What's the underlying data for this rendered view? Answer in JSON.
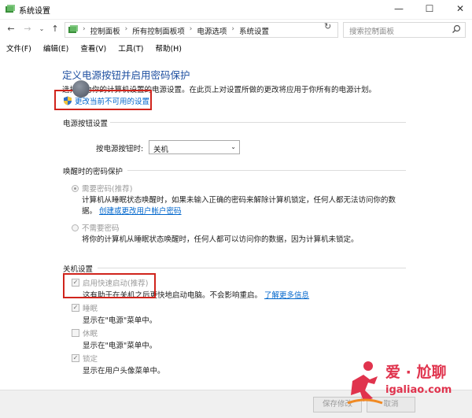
{
  "window": {
    "title": "系统设置",
    "min": "—",
    "max": "☐",
    "close": "✕"
  },
  "address": {
    "crumbs": [
      "控制面板",
      "所有控制面板项",
      "电源选项",
      "系统设置"
    ],
    "search_placeholder": "搜索控制面板"
  },
  "menu": [
    "文件(F)",
    "编辑(E)",
    "查看(V)",
    "工具(T)",
    "帮助(H)"
  ],
  "main": {
    "heading": "定义电源按钮并启用密码保护",
    "description": "选择要为你的计算机设置的电源设置。在此页上对设置所做的更改将应用于你所有的电源计划。",
    "change_link": "更改当前不可用的设置",
    "power_button": {
      "section": "电源按钮设置",
      "label": "按电源按钮时:",
      "value": "关机"
    },
    "wake_password": {
      "section": "唤醒时的密码保护",
      "require": {
        "label": "需要密码(推荐)",
        "desc1": "计算机从睡眠状态唤醒时，如果未输入正确的密码来解除计算机锁定，任何人都无法访问你的数",
        "desc2_prefix": "据。",
        "link": "创建或更改用户帐户密码"
      },
      "no_require": {
        "label": "不需要密码",
        "desc": "将你的计算机从睡眠状态唤醒时，任何人都可以访问你的数据，因为计算机未锁定。"
      }
    },
    "shutdown": {
      "section": "关机设置",
      "fast_startup": {
        "label": "启用快速启动(推荐)",
        "desc": "这有助于在关机之后更快地启动电脑。不会影响重启。",
        "link": "了解更多信息",
        "checked": true
      },
      "sleep": {
        "label": "睡眠",
        "desc": "显示在\"电源\"菜单中。",
        "checked": true
      },
      "hibernate": {
        "label": "休眠",
        "desc": "显示在\"电源\"菜单中。",
        "checked": false
      },
      "lock": {
        "label": "锁定",
        "desc": "显示在用户头像菜单中。",
        "checked": true
      }
    }
  },
  "footer": {
    "save": "保存修改",
    "cancel": "取消"
  },
  "watermark": {
    "brand": "爱 · 尬聊",
    "url": "igaliao.com"
  },
  "colors": {
    "accent": "#1e4fa0",
    "link": "#0066cc",
    "highlight": "#d0241c"
  }
}
